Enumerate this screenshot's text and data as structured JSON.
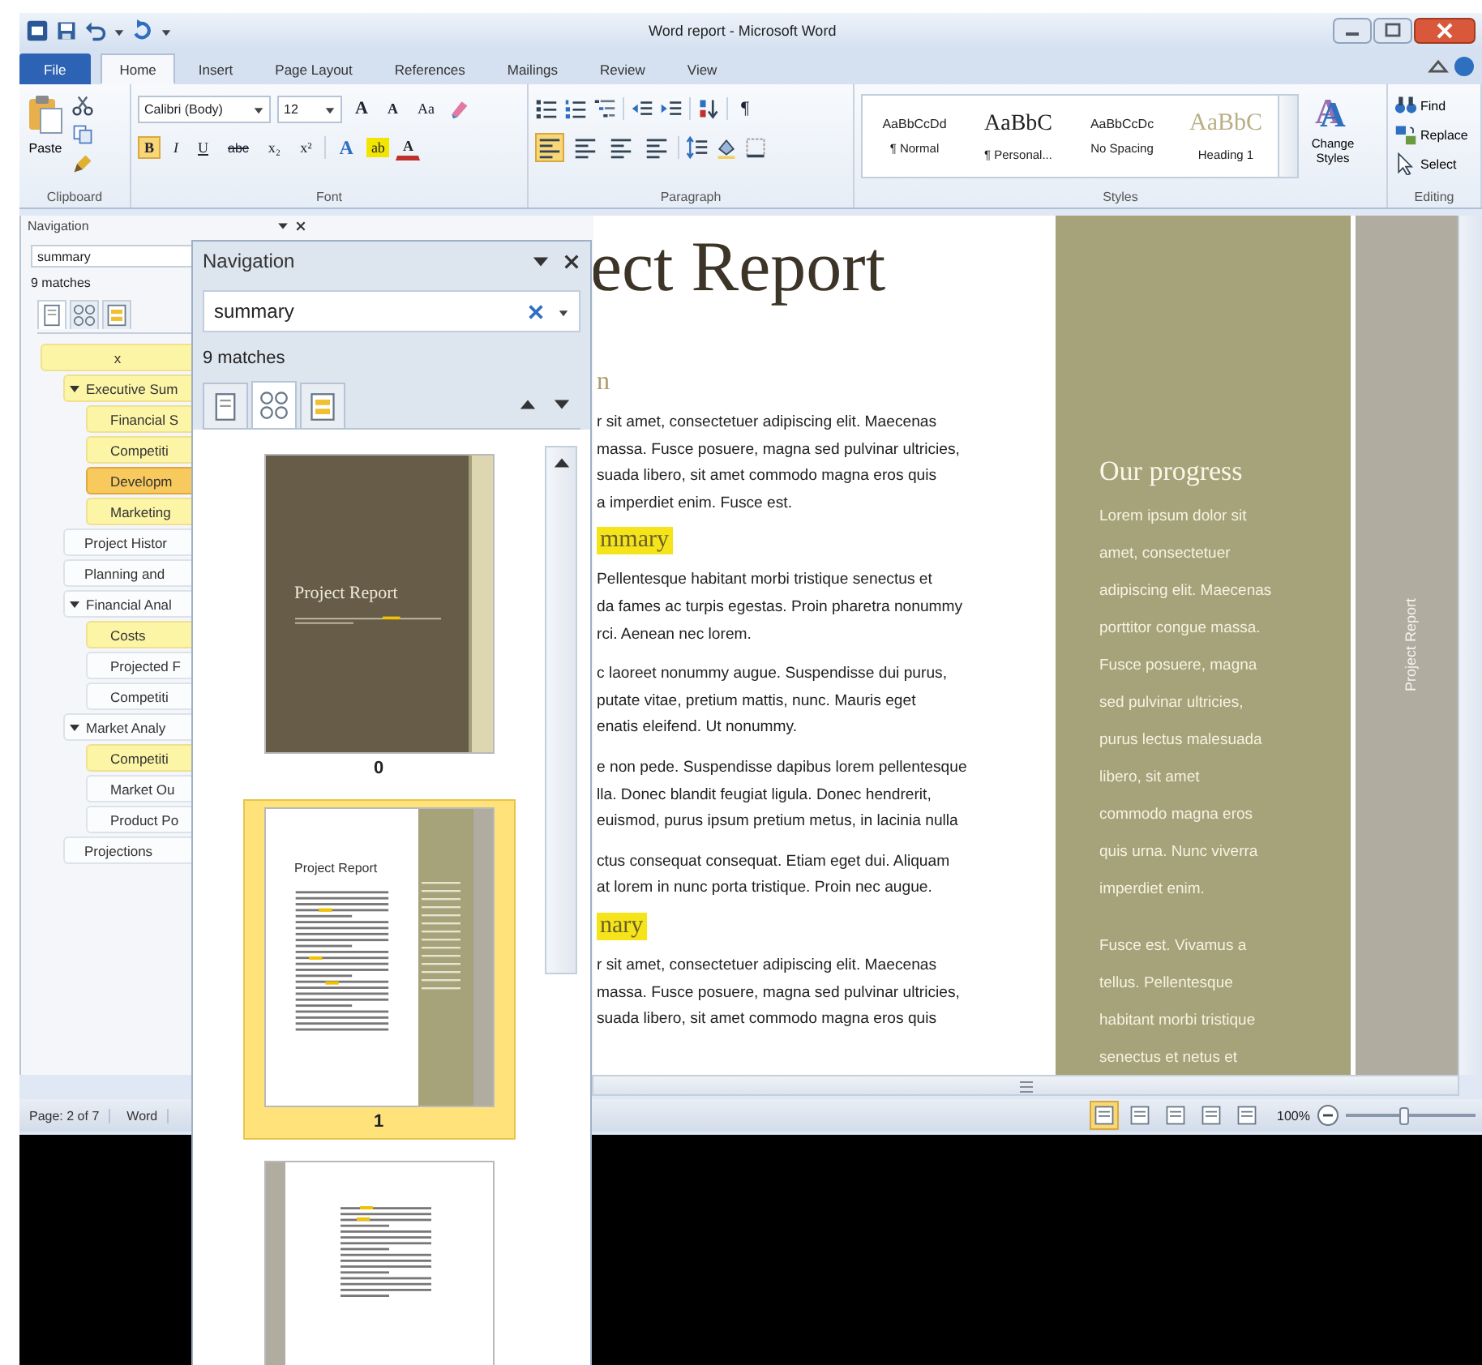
{
  "window": {
    "title": "Word report - Microsoft Word"
  },
  "tabs": [
    {
      "label": "File",
      "kind": "file",
      "selected": false
    },
    {
      "label": "Home",
      "kind": "tab",
      "selected": true
    },
    {
      "label": "Insert",
      "kind": "tab",
      "selected": false
    },
    {
      "label": "Page Layout",
      "kind": "tab",
      "selected": false
    },
    {
      "label": "References",
      "kind": "tab",
      "selected": false
    },
    {
      "label": "Mailings",
      "kind": "tab",
      "selected": false
    },
    {
      "label": "Review",
      "kind": "tab",
      "selected": false
    },
    {
      "label": "View",
      "kind": "tab",
      "selected": false
    }
  ],
  "ribbon": {
    "clipboard": {
      "label": "Clipboard",
      "paste": "Paste"
    },
    "font": {
      "label": "Font",
      "font_name": "Calibri (Body)",
      "font_size": "12",
      "row1": [
        {
          "label": "A",
          "kind": "grow"
        },
        {
          "label": "A",
          "kind": "shrink"
        },
        {
          "label": "Aa",
          "kind": "case"
        }
      ],
      "row2": [
        {
          "label": "B",
          "kind": "bold",
          "selected": true
        },
        {
          "label": "I",
          "kind": "italic",
          "selected": false
        },
        {
          "label": "U",
          "kind": "underline",
          "selected": false
        },
        {
          "label": "abc",
          "kind": "strike",
          "selected": false
        },
        {
          "label": "x₂",
          "kind": "plain",
          "selected": false
        },
        {
          "label": "x²",
          "kind": "plain",
          "selected": false
        }
      ],
      "effects": [
        {
          "label": "A",
          "kind": "effects"
        },
        {
          "label": "ab",
          "kind": "highlight"
        },
        {
          "label": "A",
          "kind": "color"
        }
      ]
    },
    "paragraph": {
      "label": "Paragraph",
      "pilcrow": "¶",
      "align": [
        {
          "selected": true
        },
        {
          "selected": false
        },
        {
          "selected": false
        },
        {
          "selected": false
        }
      ]
    },
    "styles": {
      "label": "Styles",
      "items": [
        {
          "preview": "AaBbCcDd",
          "name": "¶ Normal",
          "kind": "small"
        },
        {
          "preview": "AaBbC",
          "name": "¶ Personal...",
          "kind": "serif"
        },
        {
          "preview": "AaBbCcDc",
          "name": "No Spacing",
          "kind": "small"
        },
        {
          "preview": "AaBbC",
          "name": "Heading 1",
          "kind": "heading"
        }
      ]
    },
    "change_styles": {
      "glyph": "A",
      "label": "Change Styles"
    },
    "editing": {
      "label": "Editing",
      "items": [
        {
          "label": "Find",
          "kind": "find"
        },
        {
          "label": "Replace",
          "kind": "replace"
        },
        {
          "label": "Select",
          "kind": "select"
        }
      ]
    }
  },
  "nav_pane": {
    "title": "Navigation",
    "search": "summary",
    "matches": "9 matches",
    "views": [
      {
        "selected": true
      },
      {
        "selected": false
      },
      {
        "selected": false
      }
    ],
    "tree": [
      {
        "label": "x",
        "hit": true,
        "selected": false,
        "children": [
          {
            "label": "Executive Sum",
            "hit": true,
            "selected": false,
            "expanded": true,
            "children": [
              {
                "label": "Financial S",
                "hit": true,
                "selected": false
              },
              {
                "label": "Competiti",
                "hit": true,
                "selected": false
              },
              {
                "label": "Developm",
                "hit": true,
                "selected": true
              },
              {
                "label": "Marketing",
                "hit": true,
                "selected": false
              }
            ]
          },
          {
            "label": "Project Histor",
            "hit": false,
            "selected": false
          },
          {
            "label": "Planning and",
            "hit": false,
            "selected": false
          },
          {
            "label": "Financial Anal",
            "hit": false,
            "selected": false,
            "expanded": true,
            "children": [
              {
                "label": "Costs",
                "hit": true,
                "selected": false
              },
              {
                "label": "Projected F",
                "hit": false,
                "selected": false
              },
              {
                "label": "Competiti",
                "hit": false,
                "selected": false
              }
            ]
          },
          {
            "label": "Market Analy",
            "hit": false,
            "selected": false,
            "expanded": true,
            "children": [
              {
                "label": "Competiti",
                "hit": true,
                "selected": false
              },
              {
                "label": "Market Ou",
                "hit": false,
                "selected": false
              },
              {
                "label": "Product Po",
                "hit": false,
                "selected": false
              }
            ]
          },
          {
            "label": "Projections",
            "hit": false,
            "selected": false
          }
        ]
      }
    ]
  },
  "floating_nav": {
    "title": "Navigation",
    "search": "summary",
    "matches": "9 matches",
    "views": [
      {
        "kind": "headings",
        "selected": false
      },
      {
        "kind": "pages",
        "selected": true
      },
      {
        "kind": "results",
        "selected": false
      }
    ],
    "pages": [
      {
        "number": "0",
        "kind": "cover",
        "title": "Project Report",
        "selected": false
      },
      {
        "number": "1",
        "kind": "content",
        "title": "Project Report",
        "selected": true
      },
      {
        "kind": "content-left",
        "selected": false
      }
    ]
  },
  "document": {
    "title": "ect Report",
    "subtitle": "n",
    "blocks": [
      {
        "kind": "para",
        "lines": [
          "r sit amet, consectetuer adipiscing elit. Maecenas",
          "massa. Fusce posuere, magna sed pulvinar ultricies,",
          "suada libero, sit amet commodo magna eros quis",
          "a imperdiet enim. Fusce est."
        ]
      },
      {
        "kind": "hit",
        "text": "mmary"
      },
      {
        "kind": "para",
        "lines": [
          "Pellentesque habitant morbi tristique senectus et",
          "da fames ac turpis egestas. Proin pharetra nonummy",
          "rci. Aenean nec lorem."
        ]
      },
      {
        "kind": "para",
        "lines": [
          "c laoreet nonummy augue. Suspendisse dui purus,",
          "putate vitae, pretium mattis, nunc. Mauris eget",
          "enatis eleifend. Ut nonummy."
        ]
      },
      {
        "kind": "para",
        "lines": [
          "e non pede. Suspendisse dapibus lorem pellentesque",
          "lla. Donec blandit feugiat ligula. Donec hendrerit,",
          "euismod, purus ipsum pretium metus, in lacinia nulla"
        ]
      },
      {
        "kind": "para",
        "lines": [
          "ctus consequat consequat. Etiam eget dui. Aliquam",
          "at lorem in nunc porta tristique. Proin nec augue."
        ]
      },
      {
        "kind": "hit",
        "text": "nary"
      },
      {
        "kind": "para",
        "lines": [
          "r sit amet, consectetuer adipiscing elit. Maecenas",
          "massa. Fusce posuere, magna sed pulvinar ultricies,",
          "suada libero, sit amet commodo magna eros quis"
        ]
      }
    ],
    "sidebar": {
      "heading": "Our progress",
      "paragraphs": [
        [
          "Lorem ipsum dolor sit",
          "amet, consectetuer",
          "adipiscing elit. Maecenas",
          "porttitor congue massa.",
          "Fusce posuere, magna",
          "sed pulvinar ultricies,",
          "purus lectus malesuada",
          "libero, sit amet",
          "commodo magna eros",
          "quis urna. Nunc viverra",
          "imperdiet enim."
        ],
        [
          "Fusce est. Vivamus a",
          "tellus. Pellentesque",
          "habitant morbi tristique",
          "senectus et netus et"
        ]
      ]
    },
    "side_tab": "Project Report"
  },
  "status_bar": {
    "page": "Page: 2 of 7",
    "words": "Word",
    "views": [
      {
        "selected": true
      },
      {
        "selected": false
      },
      {
        "selected": false
      },
      {
        "selected": false
      },
      {
        "selected": false
      }
    ],
    "zoom": "100%",
    "zoom_slider": {
      "level": 0.45
    }
  }
}
